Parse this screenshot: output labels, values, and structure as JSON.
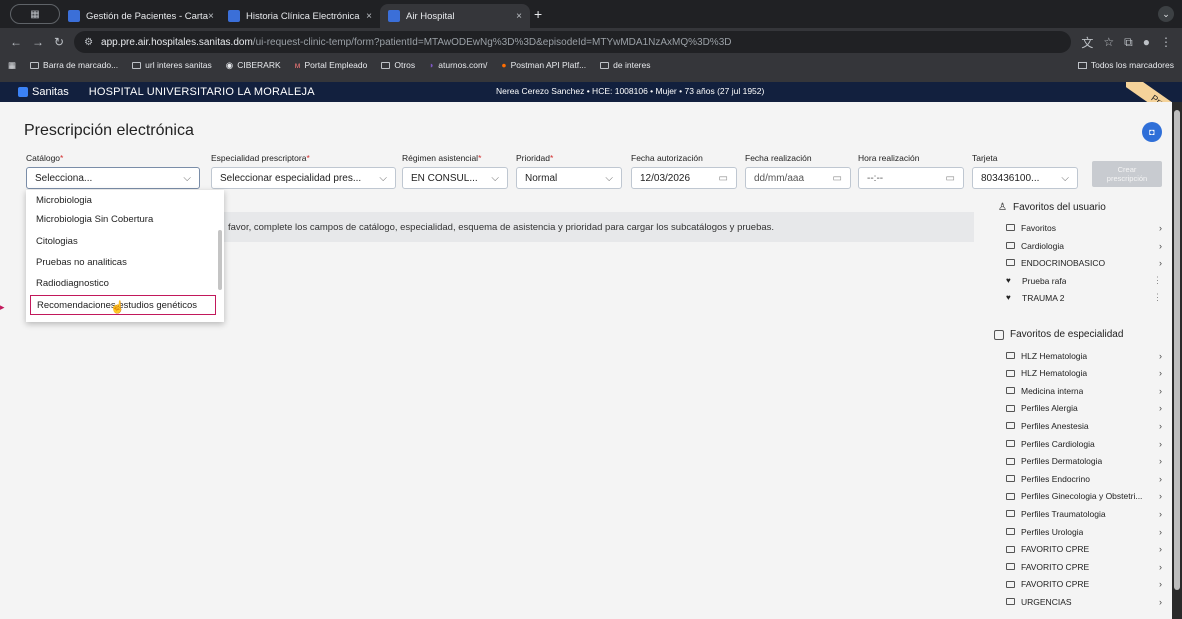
{
  "browser": {
    "tabs": [
      {
        "label": "Gestión de Pacientes - Carta",
        "active": false
      },
      {
        "label": "Historia Clínica Electrónica",
        "active": false
      },
      {
        "label": "Air Hospital",
        "active": true
      }
    ],
    "url_host": "app.pre.air.hospitales.sanitas.dom",
    "url_path": "/ui-request-clinic-temp/form?patientId=MTAwODEwNg%3D%3D&episodeId=MTYwMDA1NzAxMQ%3D%3D",
    "bookmarks": [
      "Barra de marcado...",
      "url interes sanitas",
      "CIBERARK",
      "Portal Empleado",
      "Otros",
      "aturnos.com/",
      "Postman API Platf...",
      "de interes"
    ],
    "bookmarks_right": "Todos los marcadores"
  },
  "header": {
    "logo": "Sanitas",
    "hospital": "HOSPITAL UNIVERSITARIO LA MORALEJA",
    "patient": "Nerea Cerezo Sanchez • HCE: 1008106 • Mujer • 73 años (27 jul 1952)",
    "env_badge": "Pre"
  },
  "page": {
    "title": "Prescripción electrónica",
    "notice": "favor, complete los campos de catálogo, especialidad, esquema de asistencia y prioridad para cargar los subcatálogos y pruebas.",
    "create_button": [
      "Crear",
      "prescripción"
    ]
  },
  "form": {
    "catalogo": {
      "label": "Catálogo",
      "value": "Selecciona..."
    },
    "especialidad": {
      "label": "Especialidad prescriptora",
      "value": "Seleccionar especialidad pres..."
    },
    "regimen": {
      "label": "Régimen asistencial",
      "value": "EN CONSUL..."
    },
    "prioridad": {
      "label": "Prioridad",
      "value": "Normal"
    },
    "fecha_autorizacion": {
      "label": "Fecha autorización",
      "value": "12/03/2026"
    },
    "fecha_realizacion": {
      "label": "Fecha realización",
      "placeholder": "dd/mm/aaa"
    },
    "hora_realizacion": {
      "label": "Hora realización",
      "placeholder": "--:--"
    },
    "tarjeta": {
      "label": "Tarjeta",
      "value": "803436100..."
    }
  },
  "catalog_dropdown": {
    "options": [
      "Microbiologia",
      "Microbiologia Sin Cobertura",
      "Citologias",
      "Pruebas no analiticas",
      "Radiodiagnostico",
      "Recomendaciones estudios genéticos"
    ],
    "hovered": "Recomendaciones estudios genéticos"
  },
  "favorites_user": {
    "title": "Favoritos del usuario",
    "items": [
      {
        "label": "Favoritos",
        "kind": "folder"
      },
      {
        "label": "Cardiologia",
        "kind": "folder"
      },
      {
        "label": "ENDOCRINOBASICO",
        "kind": "folder"
      },
      {
        "label": "Prueba rafa",
        "kind": "heart"
      },
      {
        "label": "TRAUMA 2",
        "kind": "heart"
      }
    ]
  },
  "favorites_specialty": {
    "title": "Favoritos de especialidad",
    "items": [
      "HLZ Hematologia",
      "HLZ Hematologia",
      "Medicina interna",
      "Perfiles Alergia",
      "Perfiles Anestesia",
      "Perfiles Cardiologia",
      "Perfiles Dermatologia",
      "Perfiles Endocrino",
      "Perfiles Ginecologia y Obstetri...",
      "Perfiles Traumatologia",
      "Perfiles Urologia",
      "FAVORITO CPRE",
      "FAVORITO CPRE",
      "FAVORITO CPRE",
      "URGENCIAS"
    ]
  }
}
